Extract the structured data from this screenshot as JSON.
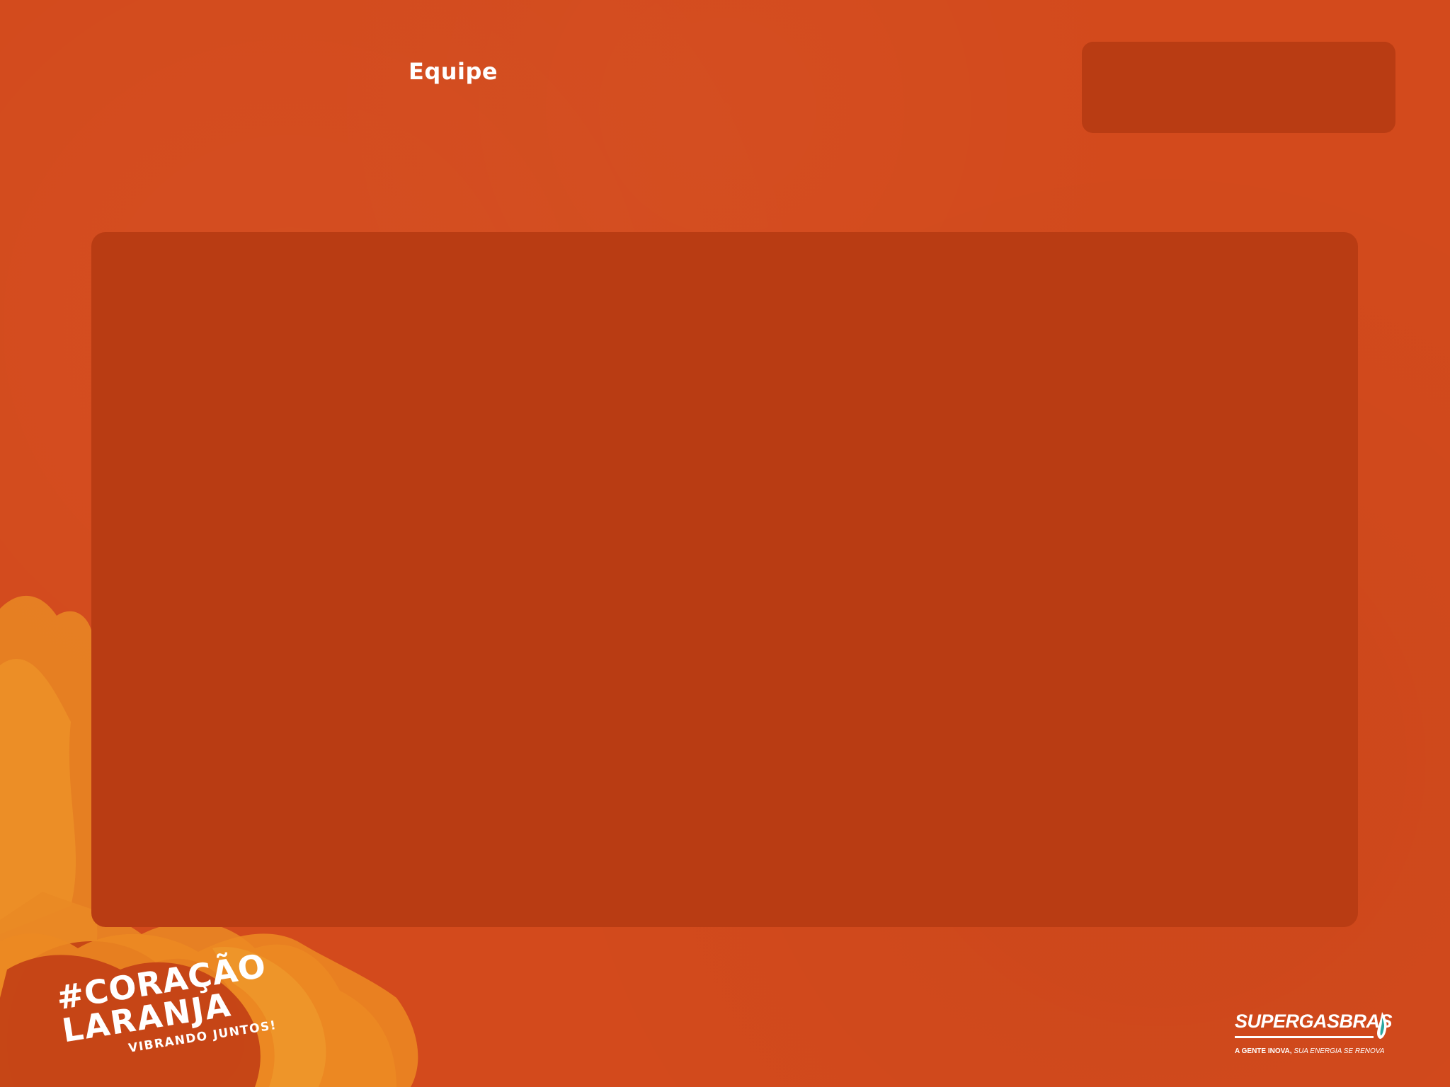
{
  "header": {
    "title": "Equipe"
  },
  "branding": {
    "hashtag_line1": "#CORAÇÃO",
    "hashtag_line2": "LARANJA",
    "hashtag_tagline": "VIBRANDO JUNTOS!",
    "sponsor_name": "SUPERGASBRAS",
    "sponsor_tagline_bold": "A GENTE INOVA,",
    "sponsor_tagline_italic": " SUA ENERGIA SE RENOVA",
    "logo_icon": "flame-icon"
  },
  "colors": {
    "background": "#d34a1c",
    "panel": "#b93c13",
    "splash_yellow": "#ec8a22",
    "text": "#ffffff"
  }
}
